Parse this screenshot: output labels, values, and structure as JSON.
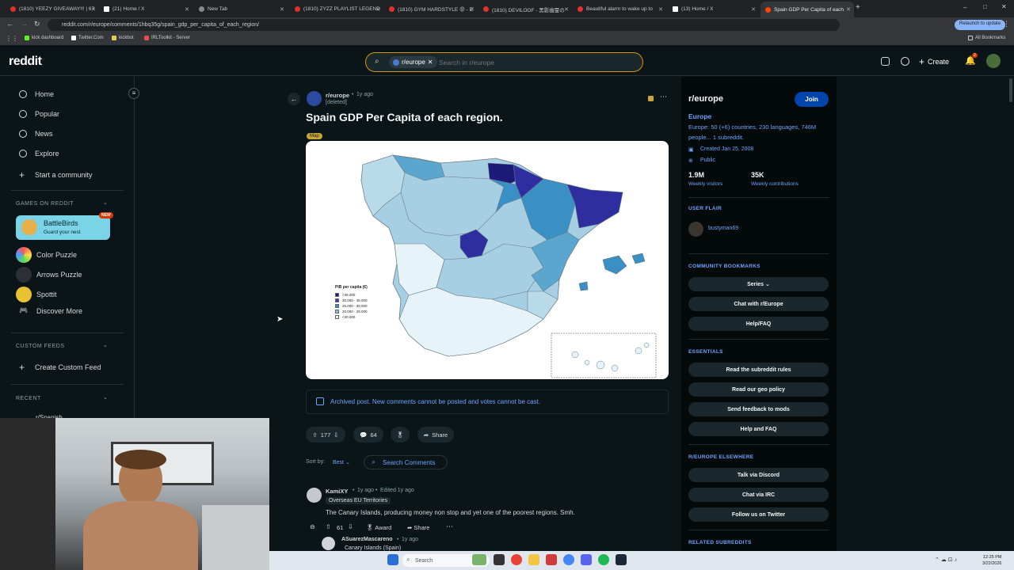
{
  "browser": {
    "tabs": [
      {
        "title": "(1810) YEEZY GIVEAWAY!!! | 67",
        "type": "yt"
      },
      {
        "title": "(21) Home / X",
        "type": "x"
      },
      {
        "title": "New Tab",
        "type": "nt"
      },
      {
        "title": "(1810) ZYZZ PLAYLIST LEGEND",
        "type": "yt"
      },
      {
        "title": "(1810) GYM HARDSTYLE 😡 - E",
        "type": "yt"
      },
      {
        "title": "(1810) DEVILOOF - 黑影幽霊の",
        "type": "yt"
      },
      {
        "title": "Beautiful alarm to wake up to",
        "type": "yt"
      },
      {
        "title": "(13) Home / X",
        "type": "x"
      },
      {
        "title": "Spain GDP Per Capita of each",
        "type": "rd"
      }
    ],
    "new_tab_symbol": "+",
    "url": "reddit.com/r/europe/comments/1hbq35g/spain_gdp_per_capita_of_each_region/",
    "relaunch_label": "Relaunch to update",
    "bookmarks": [
      "kick dashboard",
      "Twitter.Com",
      "kickbot",
      "IRLToolkit - Server"
    ],
    "all_bookmarks": "All Bookmarks"
  },
  "header": {
    "logo": "reddit",
    "search_chip": "r/europe",
    "search_placeholder": "Search in r/europe",
    "create_label": "Create",
    "notif_count": "2"
  },
  "left_sidebar": {
    "nav": [
      "Home",
      "Popular",
      "News",
      "Explore",
      "Start a community"
    ],
    "games_title": "GAMES ON REDDIT",
    "battlebirds": {
      "name": "BattleBirds",
      "sub": "Guard your nest",
      "badge": "NEW"
    },
    "games": [
      "Color Puzzle",
      "Arrows Puzzle",
      "Spottit",
      "Discover More"
    ],
    "custom_feeds_title": "CUSTOM FEEDS",
    "create_feed": "Create Custom Feed",
    "recent_title": "RECENT",
    "recent_first": "r/Spanish"
  },
  "post": {
    "subreddit": "r/europe",
    "age": "1y ago",
    "author": "[deleted]",
    "title": "Spain GDP Per Capita of each region.",
    "flair": "Map",
    "legend_title": "PIB per capita (€)",
    "legend": [
      ">35.000",
      "30.000 - 35.000",
      "25.000 - 30.000",
      "20.000 - 25.000",
      "<20.000"
    ],
    "legend_colors": [
      "#1a1a6e",
      "#3c3ca8",
      "#3a8fc4",
      "#8cc0dc",
      "#e6f3f8"
    ],
    "archived": "Archived post. New comments cannot be posted and votes cannot be cast.",
    "votes": "177",
    "comments": "64",
    "share": "Share",
    "sort_label": "Sort by:",
    "sort_value": "Best",
    "search_comments": "Search Comments"
  },
  "comments": [
    {
      "author": "KamiXY",
      "age": "1y ago",
      "edited": "Edited 1y ago",
      "flair": "Overseas EU Territories",
      "text": "The Canary Islands, producing money non stop and yet one of the poorest regions. Smh.",
      "votes": "61",
      "award": "Award",
      "share": "Share"
    },
    {
      "author": "ASuarezMascareno",
      "age": "1y ago",
      "flair": "Canary Islands (Spain)"
    }
  ],
  "right_sidebar": {
    "name": "r/europe",
    "join": "Join",
    "title": "Europe",
    "desc": "Europe: 50 (+6) countries, 230 languages, 746M people... 1 subreddit.",
    "created": "Created Jan 25, 2008",
    "visibility": "Public",
    "visitors": "1.9M",
    "visitors_label": "Weekly visitors",
    "contrib": "35K",
    "contrib_label": "Weekly contributions",
    "user_flair_title": "USER FLAIR",
    "user_flair": "bustyman69",
    "bookmarks_title": "COMMUNITY BOOKMARKS",
    "bookmarks": [
      "Series",
      "Chat with r/Europe",
      "Help/FAQ"
    ],
    "essentials_title": "ESSENTIALS",
    "essentials": [
      "Read the subreddit rules",
      "Read our geo policy",
      "Send feedback to mods",
      "Help and FAQ"
    ],
    "elsewhere_title": "R/EUROPE ELSEWHERE",
    "elsewhere": [
      "Talk via Discord",
      "Chat via IRC",
      "Follow us on Twitter"
    ],
    "related_title": "RELATED SUBREDDITS"
  },
  "taskbar": {
    "search": "Search",
    "time": "12:25 PM",
    "date": "3/22/2026"
  }
}
